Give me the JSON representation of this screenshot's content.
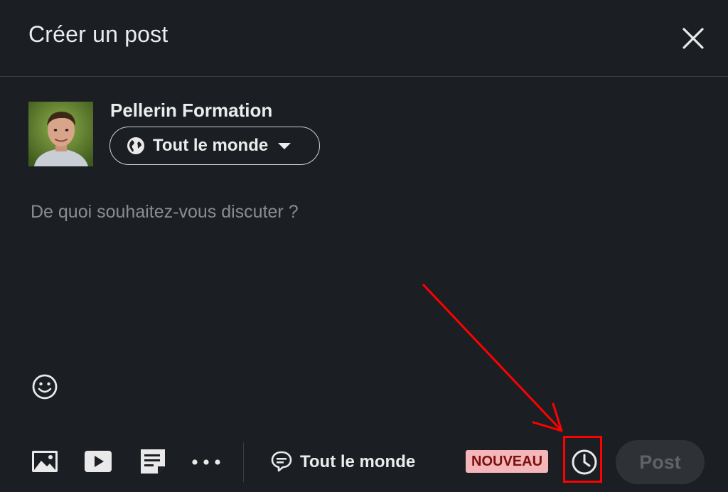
{
  "dialog": {
    "title": "Créer un post"
  },
  "author": {
    "name": "Pellerin Formation"
  },
  "audience": {
    "label": "Tout le monde"
  },
  "editor": {
    "placeholder": "De quoi souhaitez-vous discuter ?"
  },
  "toolbar": {
    "comment_control_label": "Tout le monde",
    "badge": "NOUVEAU",
    "post_label": "Post",
    "icons": [
      "image-icon",
      "video-icon",
      "document-icon",
      "more-icon",
      "comment-icon",
      "clock-icon"
    ]
  },
  "colors": {
    "background": "#1b1f23",
    "badge_bg": "#f4b6b8",
    "annotation": "#ff0000",
    "post_disabled_bg": "#2e3236"
  }
}
